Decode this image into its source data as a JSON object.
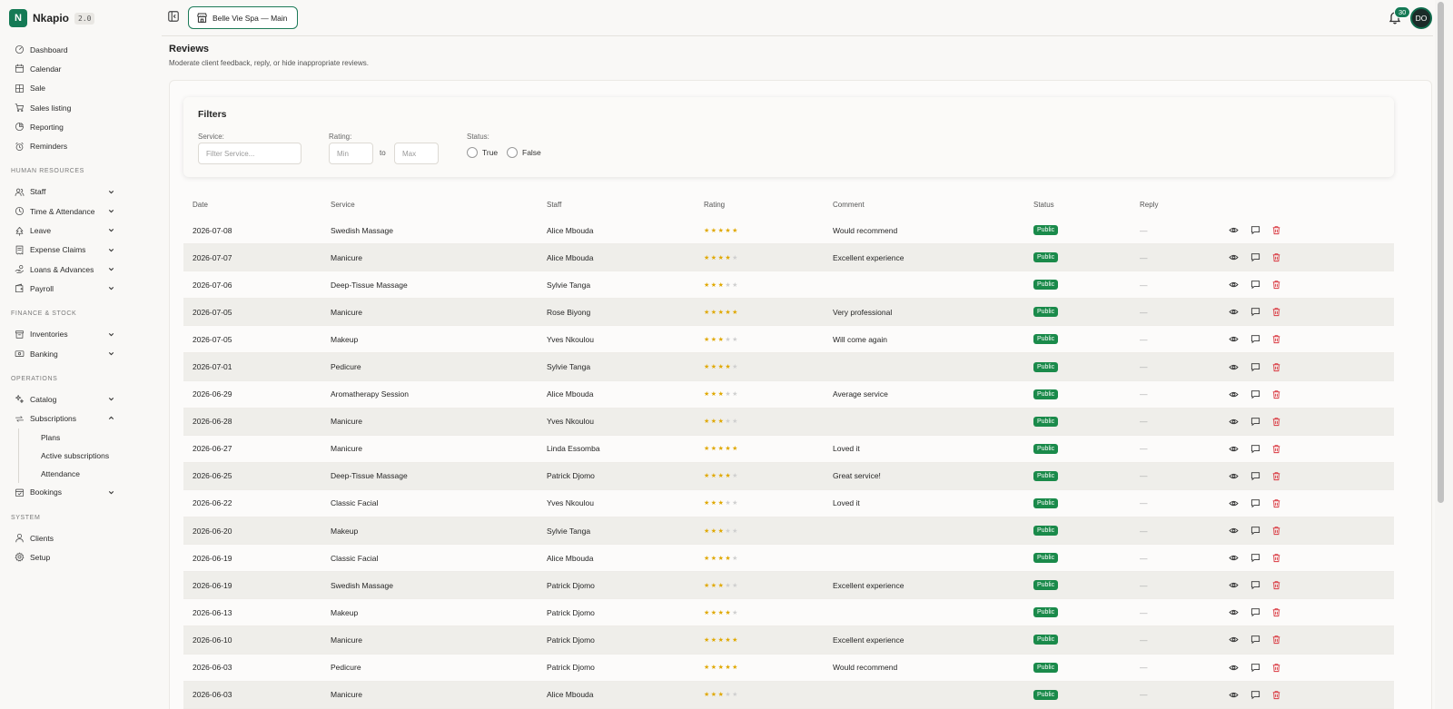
{
  "app": {
    "name": "Nkapio",
    "version": "2.0"
  },
  "sidebar": {
    "top_items": [
      {
        "label": "Dashboard",
        "icon": "gauge-icon"
      },
      {
        "label": "Calendar",
        "icon": "calendar-icon"
      },
      {
        "label": "Sale",
        "icon": "grid-icon"
      },
      {
        "label": "Sales listing",
        "icon": "cart-icon"
      },
      {
        "label": "Reporting",
        "icon": "pie-icon"
      },
      {
        "label": "Reminders",
        "icon": "alarm-icon"
      }
    ],
    "sections": [
      {
        "title": "HUMAN RESOURCES",
        "items": [
          {
            "label": "Staff",
            "icon": "users-icon",
            "expanded": false
          },
          {
            "label": "Time & Attendance",
            "icon": "clock-icon",
            "expanded": false
          },
          {
            "label": "Leave",
            "icon": "tree-icon",
            "expanded": false
          },
          {
            "label": "Expense Claims",
            "icon": "receipt-icon",
            "expanded": false
          },
          {
            "label": "Loans & Advances",
            "icon": "handcoins-icon",
            "expanded": false
          },
          {
            "label": "Payroll",
            "icon": "wallet-icon",
            "expanded": false
          }
        ]
      },
      {
        "title": "FINANCE & STOCK",
        "items": [
          {
            "label": "Inventories",
            "icon": "box-icon",
            "expanded": false
          },
          {
            "label": "Banking",
            "icon": "bank-icon",
            "expanded": false
          }
        ]
      },
      {
        "title": "OPERATIONS",
        "items": [
          {
            "label": "Catalog",
            "icon": "sparkles-icon",
            "expanded": false
          },
          {
            "label": "Subscriptions",
            "icon": "repeat-icon",
            "expanded": true,
            "children": [
              "Plans",
              "Active subscriptions",
              "Attendance"
            ]
          },
          {
            "label": "Bookings",
            "icon": "book-icon",
            "expanded": false
          }
        ]
      },
      {
        "title": "SYSTEM",
        "items": [
          {
            "label": "Clients",
            "icon": "user-icon"
          },
          {
            "label": "Setup",
            "icon": "settings-icon"
          }
        ]
      }
    ]
  },
  "topbar": {
    "branch": "Belle Vie Spa — Main",
    "notifications": "30",
    "avatar": "DO"
  },
  "page": {
    "title": "Reviews",
    "subtitle": "Moderate client feedback, reply, or hide inappropriate reviews."
  },
  "filters": {
    "title": "Filters",
    "service_label": "Service:",
    "service_placeholder": "Filter Service...",
    "rating_label": "Rating:",
    "min_placeholder": "Min",
    "to": "to",
    "max_placeholder": "Max",
    "status_label": "Status:",
    "status_true": "True",
    "status_false": "False"
  },
  "table": {
    "columns": [
      "Date",
      "Service",
      "Staff",
      "Rating",
      "Comment",
      "Status",
      "Reply"
    ],
    "rows": [
      {
        "date": "2026-07-08",
        "service": "Swedish Massage",
        "staff": "Alice Mbouda",
        "rating": 5,
        "comment": "Would recommend",
        "status": "Public",
        "reply": "—"
      },
      {
        "date": "2026-07-07",
        "service": "Manicure",
        "staff": "Alice Mbouda",
        "rating": 4,
        "comment": "Excellent experience",
        "status": "Public",
        "reply": "—"
      },
      {
        "date": "2026-07-06",
        "service": "Deep-Tissue Massage",
        "staff": "Sylvie Tanga",
        "rating": 3,
        "comment": "",
        "status": "Public",
        "reply": "—"
      },
      {
        "date": "2026-07-05",
        "service": "Manicure",
        "staff": "Rose Biyong",
        "rating": 5,
        "comment": "Very professional",
        "status": "Public",
        "reply": "—"
      },
      {
        "date": "2026-07-05",
        "service": "Makeup",
        "staff": "Yves Nkoulou",
        "rating": 3,
        "comment": "Will come again",
        "status": "Public",
        "reply": "—"
      },
      {
        "date": "2026-07-01",
        "service": "Pedicure",
        "staff": "Sylvie Tanga",
        "rating": 4,
        "comment": "",
        "status": "Public",
        "reply": "—"
      },
      {
        "date": "2026-06-29",
        "service": "Aromatherapy Session",
        "staff": "Alice Mbouda",
        "rating": 3,
        "comment": "Average service",
        "status": "Public",
        "reply": "—"
      },
      {
        "date": "2026-06-28",
        "service": "Manicure",
        "staff": "Yves Nkoulou",
        "rating": 3,
        "comment": "",
        "status": "Public",
        "reply": "—"
      },
      {
        "date": "2026-06-27",
        "service": "Manicure",
        "staff": "Linda Essomba",
        "rating": 5,
        "comment": "Loved it",
        "status": "Public",
        "reply": "—"
      },
      {
        "date": "2026-06-25",
        "service": "Deep-Tissue Massage",
        "staff": "Patrick Djomo",
        "rating": 4,
        "comment": "Great service!",
        "status": "Public",
        "reply": "—"
      },
      {
        "date": "2026-06-22",
        "service": "Classic Facial",
        "staff": "Yves Nkoulou",
        "rating": 3,
        "comment": "Loved it",
        "status": "Public",
        "reply": "—"
      },
      {
        "date": "2026-06-20",
        "service": "Makeup",
        "staff": "Sylvie Tanga",
        "rating": 3,
        "comment": "",
        "status": "Public",
        "reply": "—"
      },
      {
        "date": "2026-06-19",
        "service": "Classic Facial",
        "staff": "Alice Mbouda",
        "rating": 4,
        "comment": "",
        "status": "Public",
        "reply": "—"
      },
      {
        "date": "2026-06-19",
        "service": "Swedish Massage",
        "staff": "Patrick Djomo",
        "rating": 3,
        "comment": "Excellent experience",
        "status": "Public",
        "reply": "—"
      },
      {
        "date": "2026-06-13",
        "service": "Makeup",
        "staff": "Patrick Djomo",
        "rating": 4,
        "comment": "",
        "status": "Public",
        "reply": "—"
      },
      {
        "date": "2026-06-10",
        "service": "Manicure",
        "staff": "Patrick Djomo",
        "rating": 5,
        "comment": "Excellent experience",
        "status": "Public",
        "reply": "—"
      },
      {
        "date": "2026-06-03",
        "service": "Pedicure",
        "staff": "Patrick Djomo",
        "rating": 5,
        "comment": "Would recommend",
        "status": "Public",
        "reply": "—"
      },
      {
        "date": "2026-06-03",
        "service": "Manicure",
        "staff": "Alice Mbouda",
        "rating": 3,
        "comment": "",
        "status": "Public",
        "reply": "—"
      }
    ]
  },
  "colors": {
    "brand": "#157a55",
    "status_public": "#1a8a4a",
    "star": "#e0a800",
    "delete": "#d9363e"
  }
}
